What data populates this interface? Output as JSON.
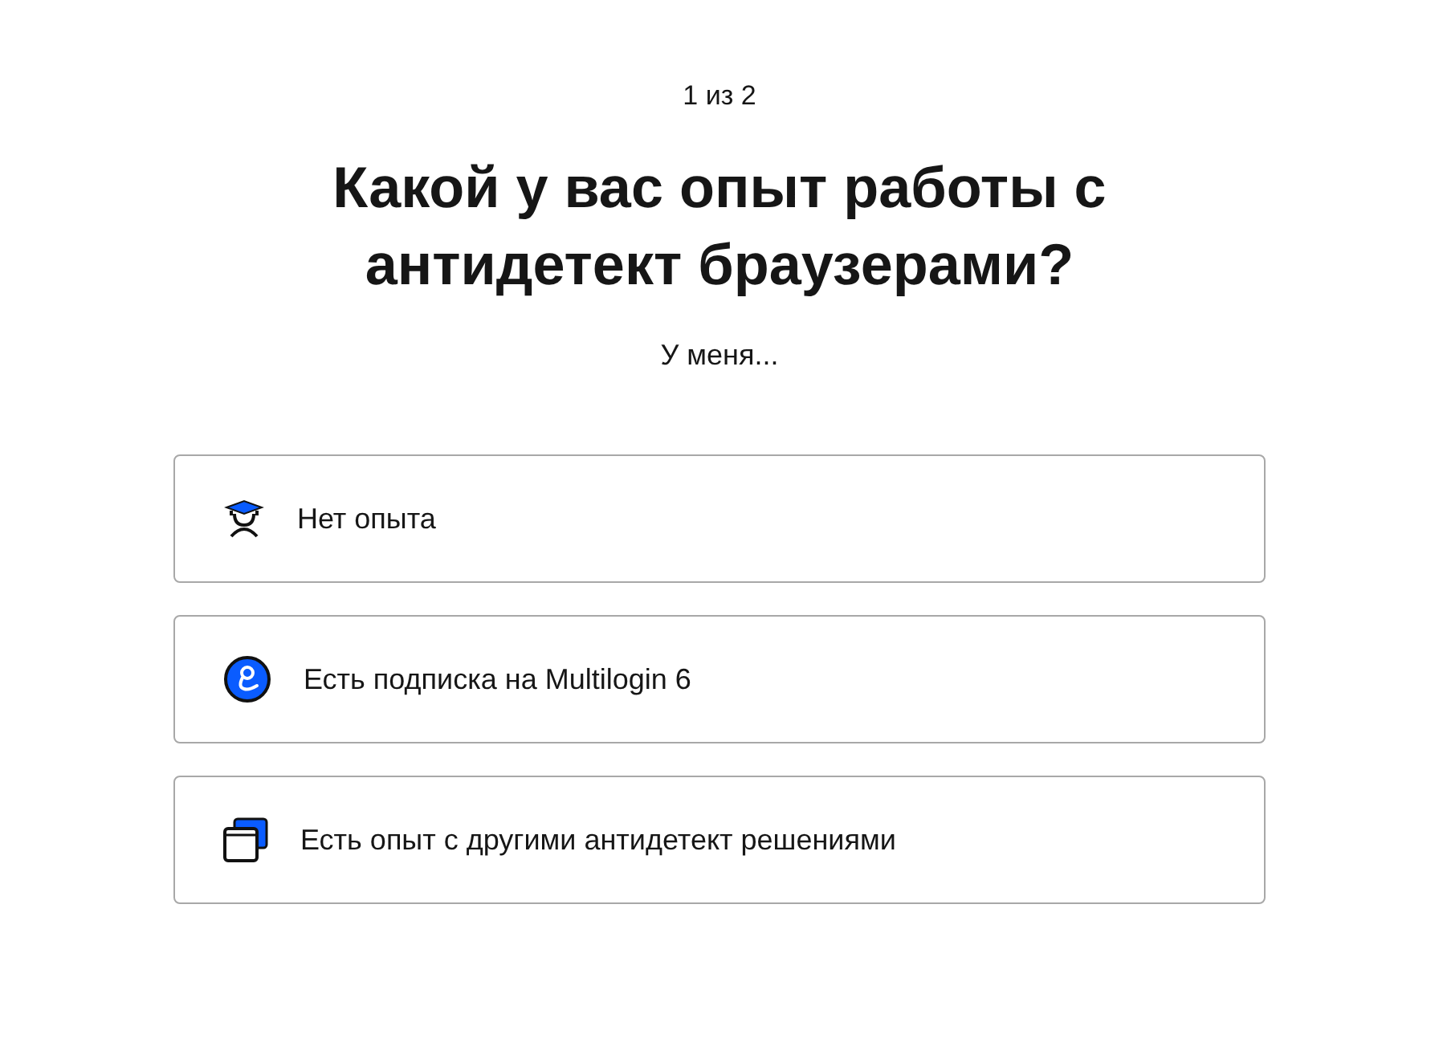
{
  "step": "1 из 2",
  "title": "Какой у вас опыт работы с антидетект браузерами?",
  "subtitle": "У меня...",
  "options": [
    {
      "kind": "novice",
      "label": "Нет опыта"
    },
    {
      "kind": "subscriber",
      "label": "Есть подписка на Multilogin 6"
    },
    {
      "kind": "other",
      "label": "Есть опыт с другими антидетект решениями"
    }
  ]
}
